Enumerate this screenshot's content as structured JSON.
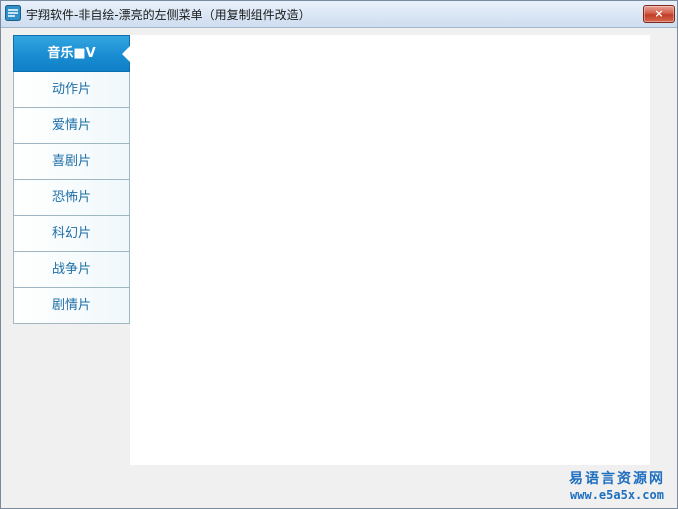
{
  "window": {
    "title": "宇翔软件-非自绘-漂亮的左侧菜单（用复制组件改造）",
    "close_symbol": "×"
  },
  "menu": {
    "items": [
      {
        "label": "音乐■V",
        "active": true
      },
      {
        "label": "动作片",
        "active": false
      },
      {
        "label": "爱情片",
        "active": false
      },
      {
        "label": "喜剧片",
        "active": false
      },
      {
        "label": "恐怖片",
        "active": false
      },
      {
        "label": "科幻片",
        "active": false
      },
      {
        "label": "战争片",
        "active": false
      },
      {
        "label": "剧情片",
        "active": false
      }
    ]
  },
  "watermark": {
    "line1": "易语言资源网",
    "line2": "www.e5a5x.com"
  },
  "icons": {
    "app": "app-logo-icon",
    "close": "close-icon"
  },
  "colors": {
    "active_item": "#1b8fd3",
    "item_text": "#1d6fa8",
    "watermark": "#1f6fc0"
  }
}
